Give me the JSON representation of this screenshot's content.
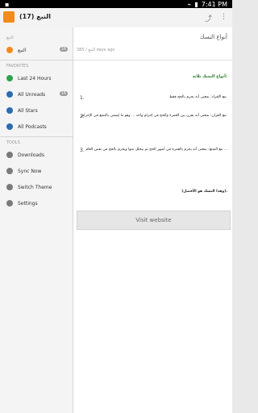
{
  "status": {
    "left": "◼",
    "time": "7:41 PM",
    "icons": [
      "wifi-icon",
      "battery-icon"
    ]
  },
  "actionbar": {
    "title": "النبع (17)",
    "share_icon": "share-icon",
    "more_icon": "more-icon"
  },
  "sidebar": {
    "top_section": "النبع",
    "feed_item": {
      "label": "النبع",
      "count": "16"
    },
    "favorites_title": "FAVORITES",
    "favorites": [
      {
        "label": "Last 24 Hours",
        "icon": "clock-icon",
        "color": "#2ea44f"
      },
      {
        "label": "All Unreads",
        "icon": "unread-icon",
        "color": "#2b6cb0",
        "count": "16"
      },
      {
        "label": "All Stars",
        "icon": "star-icon",
        "color": "#2b6cb0"
      },
      {
        "label": "All Podcasts",
        "icon": "podcast-icon",
        "color": "#2b6cb0"
      }
    ],
    "tools_title": "TOOLS",
    "tools": [
      {
        "label": "Downloads",
        "icon": "download-icon",
        "color": "#7a7a7a"
      },
      {
        "label": "Sync Now",
        "icon": "sync-icon",
        "color": "#7a7a7a"
      },
      {
        "label": "Switch Theme",
        "icon": "theme-icon",
        "color": "#7a7a7a"
      },
      {
        "label": "Settings",
        "icon": "gear-icon",
        "color": "#7a7a7a"
      }
    ]
  },
  "article": {
    "title": "أنواع النسك",
    "meta": "385 / النبع days ago",
    "heading": "أنواع النسك ثلاثة:",
    "items": [
      {
        "num": "1.",
        "text": "مع الإفراد: بمعنى أنه يحرم بالحج فقط."
      },
      {
        "num": "2.",
        "text": "مع القران: بمعنى أنه يقرن بين العمرة والحج في إحرام واحد ... وهو ما يُسمى بالتمتع في الإحرام."
      },
      {
        "num": "3.",
        "text": "مع التمتع: بمعنى أنه يحرم بالعمرة في أشهر الحج ثم يتحلل منها ويحرم بالحج في نفس العام ..."
      }
    ],
    "closing": "(وهذا النسك هو الأفضل).",
    "visit_button": "Visit website"
  }
}
